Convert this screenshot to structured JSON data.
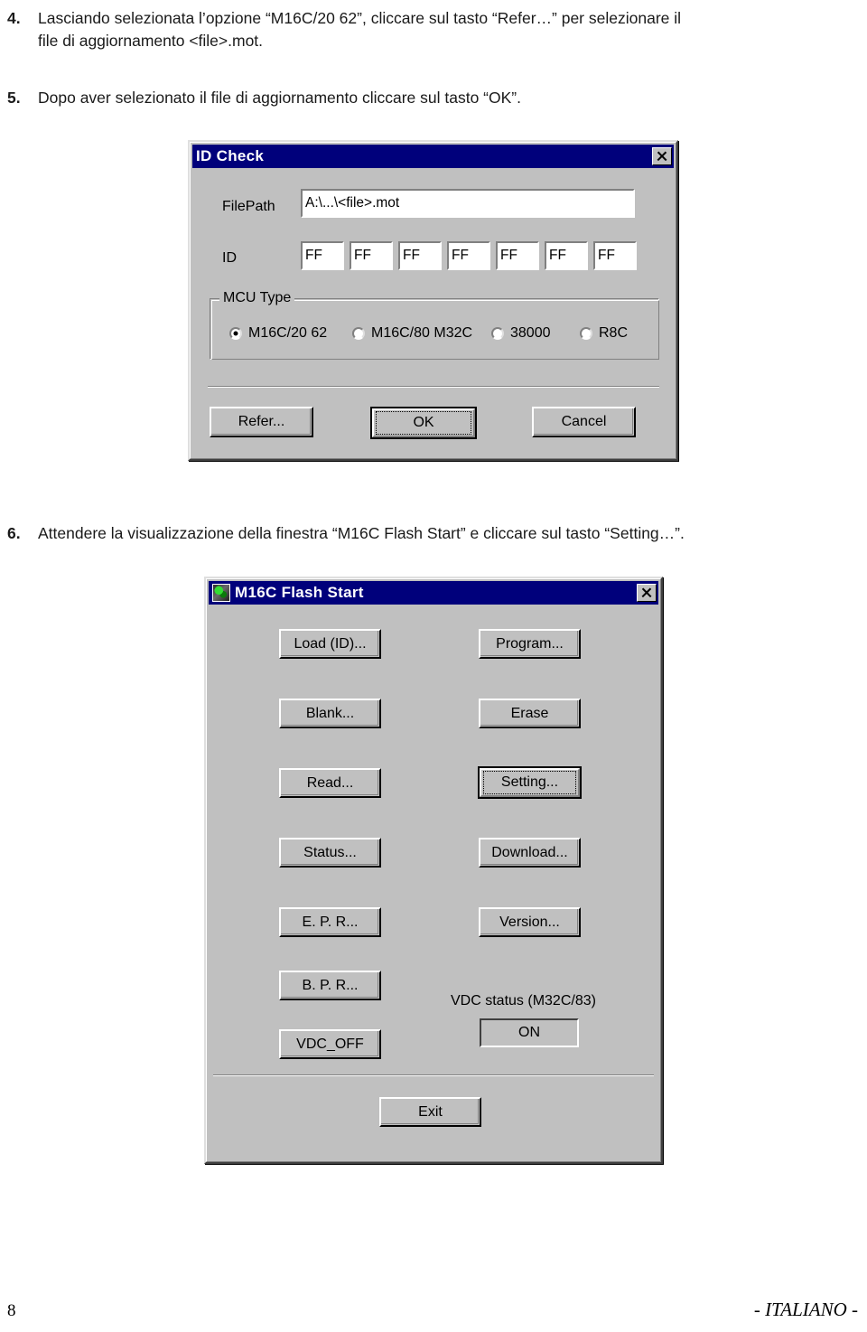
{
  "document": {
    "steps": [
      {
        "number": "4.",
        "line1": "Lasciando selezionata l’opzione “M16C/20 62”, cliccare sul tasto “Refer…” per selezionare il",
        "line2": "file di aggiornamento <file>.mot."
      },
      {
        "number": "5.",
        "line1": "Dopo aver selezionato il file di aggiornamento cliccare sul tasto “OK”.",
        "line2": ""
      },
      {
        "number": "6.",
        "line1": "Attendere la visualizzazione della finestra “M16C Flash Start” e cliccare sul tasto “Setting…”.",
        "line2": ""
      }
    ],
    "footer": {
      "page_number": "8",
      "language": "- ITALIANO -"
    }
  },
  "id_check_dialog": {
    "title": "ID Check",
    "close_label": "×",
    "filepath": {
      "label": "FilePath",
      "value": "A:\\...\\<file>.mot"
    },
    "id": {
      "label": "ID",
      "values": [
        "FF",
        "FF",
        "FF",
        "FF",
        "FF",
        "FF",
        "FF"
      ]
    },
    "mcu_type": {
      "title": "MCU Type",
      "options": [
        {
          "label": "M16C/20 62",
          "selected": true
        },
        {
          "label": "M16C/80 M32C",
          "selected": false
        },
        {
          "label": "38000",
          "selected": false
        },
        {
          "label": "R8C",
          "selected": false
        }
      ]
    },
    "buttons": {
      "refer": "Refer...",
      "ok": "OK",
      "cancel": "Cancel"
    }
  },
  "flash_start_window": {
    "title": "M16C Flash Start",
    "close_label": "×",
    "buttons": {
      "load_id": "Load (ID)...",
      "program": "Program...",
      "blank": "Blank...",
      "erase": "Erase",
      "read": "Read...",
      "setting": "Setting...",
      "status": "Status...",
      "download": "Download...",
      "epr": "E. P. R...",
      "version": "Version...",
      "bpr": "B. P. R...",
      "vdc_off": "VDC_OFF",
      "exit": "Exit"
    },
    "vdc": {
      "label": "VDC status (M32C/83)",
      "value": "ON"
    }
  },
  "colors": {
    "titlebar": "#00007b",
    "window_face": "#c0c0c0",
    "field_bg": "#ffffff"
  }
}
